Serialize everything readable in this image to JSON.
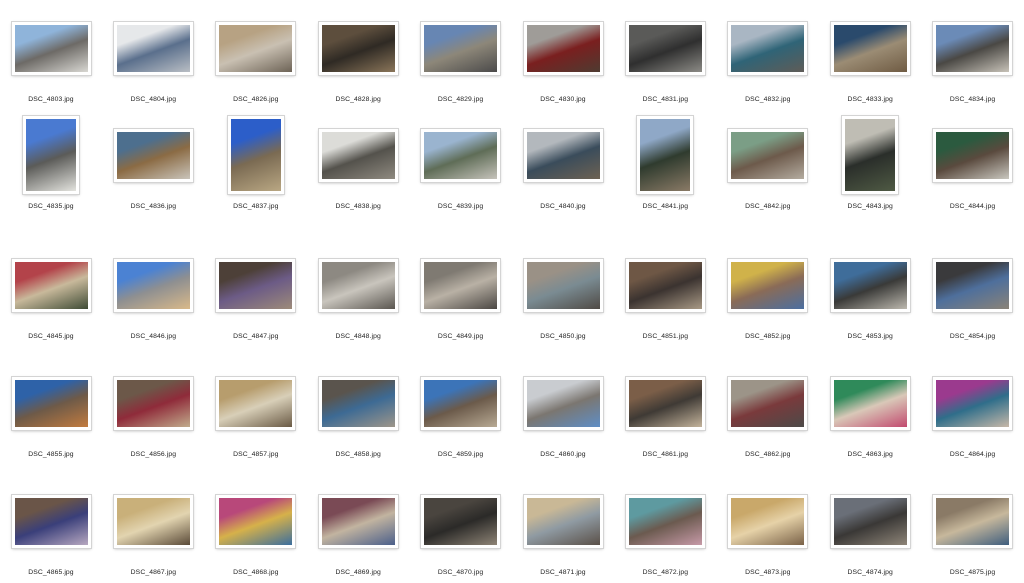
{
  "files": [
    {
      "name": "DSC_4803.jpg",
      "orientation": "landscape",
      "colors": [
        "#8fb4da",
        "#d8d7d2",
        "#6d6a66"
      ]
    },
    {
      "name": "DSC_4804.jpg",
      "orientation": "landscape",
      "colors": [
        "#e6e8ea",
        "#b9bec4",
        "#5a6f8c"
      ]
    },
    {
      "name": "DSC_4826.jpg",
      "orientation": "landscape",
      "colors": [
        "#b7a283",
        "#6d6356",
        "#c9c0b2"
      ]
    },
    {
      "name": "DSC_4828.jpg",
      "orientation": "landscape",
      "colors": [
        "#5d4e3d",
        "#8a7559",
        "#2f2a24"
      ]
    },
    {
      "name": "DSC_4829.jpg",
      "orientation": "landscape",
      "colors": [
        "#6786b3",
        "#4b4a4a",
        "#8d8779"
      ]
    },
    {
      "name": "DSC_4830.jpg",
      "orientation": "landscape",
      "colors": [
        "#9f9c98",
        "#4e3b31",
        "#7a1f1f"
      ]
    },
    {
      "name": "DSC_4831.jpg",
      "orientation": "landscape",
      "colors": [
        "#5a5a58",
        "#8c8b86",
        "#2f2f2f"
      ]
    },
    {
      "name": "DSC_4832.jpg",
      "orientation": "landscape",
      "colors": [
        "#a9b6c3",
        "#5f5c57",
        "#2f6477"
      ]
    },
    {
      "name": "DSC_4833.jpg",
      "orientation": "landscape",
      "colors": [
        "#2a4a6c",
        "#6f5b43",
        "#9b8c74"
      ]
    },
    {
      "name": "DSC_4834.jpg",
      "orientation": "landscape",
      "colors": [
        "#6b8bb7",
        "#c7c2b8",
        "#4a4844"
      ]
    },
    {
      "name": "DSC_4835.jpg",
      "orientation": "portrait",
      "colors": [
        "#4a7ad1",
        "#e3e3de",
        "#5b5b58"
      ]
    },
    {
      "name": "DSC_4836.jpg",
      "orientation": "landscape",
      "colors": [
        "#4d6f8e",
        "#c9c4ba",
        "#8b6b44"
      ]
    },
    {
      "name": "DSC_4837.jpg",
      "orientation": "portrait",
      "colors": [
        "#2c5ec9",
        "#b9a783",
        "#7a6a52"
      ]
    },
    {
      "name": "DSC_4838.jpg",
      "orientation": "landscape",
      "colors": [
        "#dcdcd8",
        "#8f8a80",
        "#54524c"
      ]
    },
    {
      "name": "DSC_4839.jpg",
      "orientation": "landscape",
      "colors": [
        "#9ab4cf",
        "#c6c3bb",
        "#5f6d57"
      ]
    },
    {
      "name": "DSC_4840.jpg",
      "orientation": "landscape",
      "colors": [
        "#b3b8bd",
        "#6d6253",
        "#3a4c5b"
      ]
    },
    {
      "name": "DSC_4841.jpg",
      "orientation": "portrait",
      "colors": [
        "#8fa8c7",
        "#8a7a66",
        "#2f3b2e"
      ]
    },
    {
      "name": "DSC_4842.jpg",
      "orientation": "landscape",
      "colors": [
        "#7b9e86",
        "#b4aca0",
        "#6d5a4b"
      ]
    },
    {
      "name": "DSC_4843.jpg",
      "orientation": "portrait",
      "colors": [
        "#bfbdb4",
        "#4f5a44",
        "#2a2e2a"
      ]
    },
    {
      "name": "DSC_4844.jpg",
      "orientation": "landscape",
      "colors": [
        "#2b5a3f",
        "#c9c7bf",
        "#5a4a3e"
      ]
    },
    {
      "name": "DSC_4845.jpg",
      "orientation": "landscape",
      "colors": [
        "#b3434a",
        "#3e4b35",
        "#c8b99b"
      ]
    },
    {
      "name": "DSC_4846.jpg",
      "orientation": "landscape",
      "colors": [
        "#4b82d3",
        "#d9b98a",
        "#8e8f91"
      ]
    },
    {
      "name": "DSC_4847.jpg",
      "orientation": "landscape",
      "colors": [
        "#4d4038",
        "#9d8b7a",
        "#6c5b86"
      ]
    },
    {
      "name": "DSC_4848.jpg",
      "orientation": "landscape",
      "colors": [
        "#8d8982",
        "#5a5650",
        "#c9c5bd"
      ]
    },
    {
      "name": "DSC_4849.jpg",
      "orientation": "landscape",
      "colors": [
        "#7f7a72",
        "#4b4743",
        "#b9b1a5"
      ]
    },
    {
      "name": "DSC_4850.jpg",
      "orientation": "landscape",
      "colors": [
        "#9a9186",
        "#4f4a45",
        "#7a8b92"
      ]
    },
    {
      "name": "DSC_4851.jpg",
      "orientation": "landscape",
      "colors": [
        "#6e5745",
        "#a89985",
        "#3b3330"
      ]
    },
    {
      "name": "DSC_4852.jpg",
      "orientation": "landscape",
      "colors": [
        "#d0b24a",
        "#4b6fa1",
        "#8a6b57"
      ]
    },
    {
      "name": "DSC_4853.jpg",
      "orientation": "landscape",
      "colors": [
        "#3f6d9a",
        "#bcb8ae",
        "#3a3a38"
      ]
    },
    {
      "name": "DSC_4854.jpg",
      "orientation": "landscape",
      "colors": [
        "#3a3a3c",
        "#8a8378",
        "#4e6f9c"
      ]
    },
    {
      "name": "DSC_4855.jpg",
      "orientation": "landscape",
      "colors": [
        "#2e62a8",
        "#c27b3f",
        "#6e5a48"
      ]
    },
    {
      "name": "DSC_4856.jpg",
      "orientation": "landscape",
      "colors": [
        "#6c5849",
        "#c1ab8c",
        "#8f2b3a"
      ]
    },
    {
      "name": "DSC_4857.jpg",
      "orientation": "landscape",
      "colors": [
        "#b79d6d",
        "#6a5a45",
        "#d8cfb8"
      ]
    },
    {
      "name": "DSC_4858.jpg",
      "orientation": "landscape",
      "colors": [
        "#5a544d",
        "#9e968a",
        "#3d6a94"
      ]
    },
    {
      "name": "DSC_4859.jpg",
      "orientation": "landscape",
      "colors": [
        "#3c74b8",
        "#b8aa94",
        "#6b5a4a"
      ]
    },
    {
      "name": "DSC_4860.jpg",
      "orientation": "landscape",
      "colors": [
        "#c9ccd0",
        "#5f8ec6",
        "#7b7670"
      ]
    },
    {
      "name": "DSC_4861.jpg",
      "orientation": "landscape",
      "colors": [
        "#7b5e48",
        "#c3b39b",
        "#3f3a35"
      ]
    },
    {
      "name": "DSC_4862.jpg",
      "orientation": "landscape",
      "colors": [
        "#9c9488",
        "#4c4a48",
        "#7a3a3c"
      ]
    },
    {
      "name": "DSC_4863.jpg",
      "orientation": "landscape",
      "colors": [
        "#2f8a5a",
        "#c24a6f",
        "#d9c8b8"
      ]
    },
    {
      "name": "DSC_4864.jpg",
      "orientation": "landscape",
      "colors": [
        "#9b3a8e",
        "#c7b8a8",
        "#2f6e8a"
      ]
    },
    {
      "name": "DSC_4865.jpg",
      "orientation": "landscape",
      "colors": [
        "#6a5548",
        "#b7a8c0",
        "#3a3f7a"
      ]
    },
    {
      "name": "DSC_4867.jpg",
      "orientation": "landscape",
      "colors": [
        "#c9b07a",
        "#5a4a38",
        "#e2d4b0"
      ]
    },
    {
      "name": "DSC_4868.jpg",
      "orientation": "landscape",
      "colors": [
        "#b8487a",
        "#3b6e9e",
        "#d6b14a"
      ]
    },
    {
      "name": "DSC_4869.jpg",
      "orientation": "landscape",
      "colors": [
        "#7a4a55",
        "#4b5f8a",
        "#c2b4a0"
      ]
    },
    {
      "name": "DSC_4870.jpg",
      "orientation": "landscape",
      "colors": [
        "#4a453f",
        "#8e8476",
        "#2b2a28"
      ]
    },
    {
      "name": "DSC_4871.jpg",
      "orientation": "landscape",
      "colors": [
        "#c9b896",
        "#5a5048",
        "#8f9aa2"
      ]
    },
    {
      "name": "DSC_4872.jpg",
      "orientation": "landscape",
      "colors": [
        "#5e9aa0",
        "#c79aa8",
        "#6b5a4f"
      ]
    },
    {
      "name": "DSC_4873.jpg",
      "orientation": "landscape",
      "colors": [
        "#c9a86a",
        "#7a6248",
        "#e6d2a8"
      ]
    },
    {
      "name": "DSC_4874.jpg",
      "orientation": "landscape",
      "colors": [
        "#6a6f78",
        "#8e8578",
        "#3a3836"
      ]
    },
    {
      "name": "DSC_4875.jpg",
      "orientation": "landscape",
      "colors": [
        "#8a7a66",
        "#3f5e7e",
        "#c7b89c"
      ]
    }
  ]
}
